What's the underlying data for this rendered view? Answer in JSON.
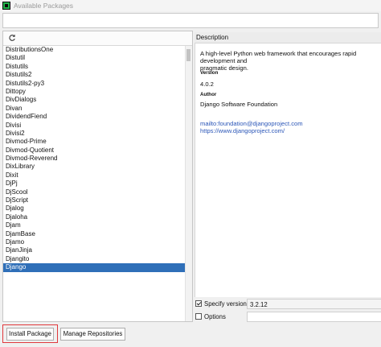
{
  "window": {
    "title": "Available Packages"
  },
  "search": {
    "value": "",
    "placeholder": ""
  },
  "packages": {
    "items": [
      "DistributionsOne",
      "Distutil",
      "Distutils",
      "Distutils2",
      "Distutils2-py3",
      "Dittopy",
      "DivDialogs",
      "Divan",
      "DividendFiend",
      "Divisi",
      "Divisi2",
      "Divmod-Prime",
      "Divmod-Quotient",
      "Divmod-Reverend",
      "DixLibrary",
      "Dixit",
      "DjPj",
      "DjScool",
      "DjScript",
      "Djalog",
      "Djaloha",
      "Djam",
      "DjamBase",
      "Djamo",
      "DjanJinja",
      "Djangito",
      "Django"
    ],
    "selected": "Django"
  },
  "description": {
    "header": "Description",
    "text_line1": "A high-level Python web framework that encourages rapid development and",
    "text_line2": "pragmatic design.",
    "version_label": "Version",
    "version_value": "4.0.2",
    "author_label": "Author",
    "author_value": "Django Software Foundation",
    "email_link": "mailto:foundation@djangoproject.com",
    "web_link": "https://www.djangoproject.com/"
  },
  "options": {
    "specify_version_label": "Specify version",
    "specify_version_checked": true,
    "specify_version_value": "3.2.12",
    "options_label": "Options",
    "options_checked": false
  },
  "buttons": {
    "install": "Install Package",
    "manage": "Manage Repositories"
  },
  "colors": {
    "selection": "#2f6fb8",
    "highlight_box": "#e0383c",
    "link": "#2c57b8"
  }
}
